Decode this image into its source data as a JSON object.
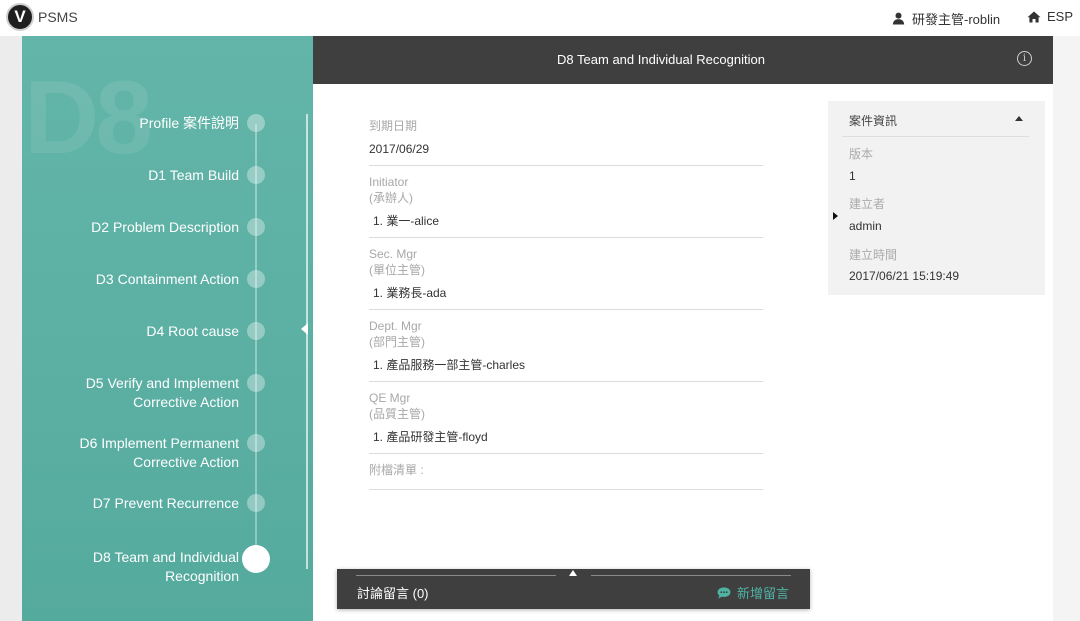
{
  "app": {
    "logo_letter": "V",
    "name": "PSMS",
    "user": "研發主管-roblin",
    "language": "ESP"
  },
  "sidebar": {
    "watermark": "D8",
    "steps": [
      {
        "code": "",
        "label": "Profile 案件說明",
        "line2": ""
      },
      {
        "code": "D1",
        "label": "Team Build",
        "line2": ""
      },
      {
        "code": "D2",
        "label": "Problem Description",
        "line2": ""
      },
      {
        "code": "D3",
        "label": "Containment Action",
        "line2": ""
      },
      {
        "code": "D4",
        "label": "Root cause",
        "line2": ""
      },
      {
        "code": "D5",
        "label": "Verify and Implement",
        "line2": "Corrective Action"
      },
      {
        "code": "D6",
        "label": "Implement Permanent",
        "line2": "Corrective Action"
      },
      {
        "code": "D7",
        "label": "Prevent Recurrence",
        "line2": ""
      },
      {
        "code": "D8",
        "label": "Team and Individual",
        "line2": "Recognition"
      }
    ]
  },
  "header": {
    "title": "D8 Team and Individual Recognition",
    "info_icon": "info-icon"
  },
  "form": {
    "due_date": {
      "label": "到期日期",
      "value": "2017/06/29"
    },
    "initiator": {
      "label": "Initiator",
      "sub": "(承辦人)",
      "value": "1. 業一-alice"
    },
    "sec_mgr": {
      "label": "Sec. Mgr",
      "sub": "(單位主管)",
      "value": "1. 業務長-ada"
    },
    "dept_mgr": {
      "label": "Dept. Mgr",
      "sub": "(部門主管)",
      "value": "1. 產品服務一部主管-charles"
    },
    "qe_mgr": {
      "label": "QE Mgr",
      "sub": "(品質主管)",
      "value": "1. 產品研發主管-floyd"
    },
    "attachments": {
      "label": "附檔清單 :"
    }
  },
  "case_info": {
    "title": "案件資訊",
    "version_label": "版本",
    "version_value": "1",
    "creator_label": "建立者",
    "creator_value": "admin",
    "created_label": "建立時間",
    "created_value": "2017/06/21 15:19:49"
  },
  "comments": {
    "label": "討論留言 (0)",
    "add_label": "新增留言"
  },
  "colors": {
    "sidebar": "#5aaea2",
    "header": "#3f3f3f",
    "accent": "#4fb3a4"
  }
}
